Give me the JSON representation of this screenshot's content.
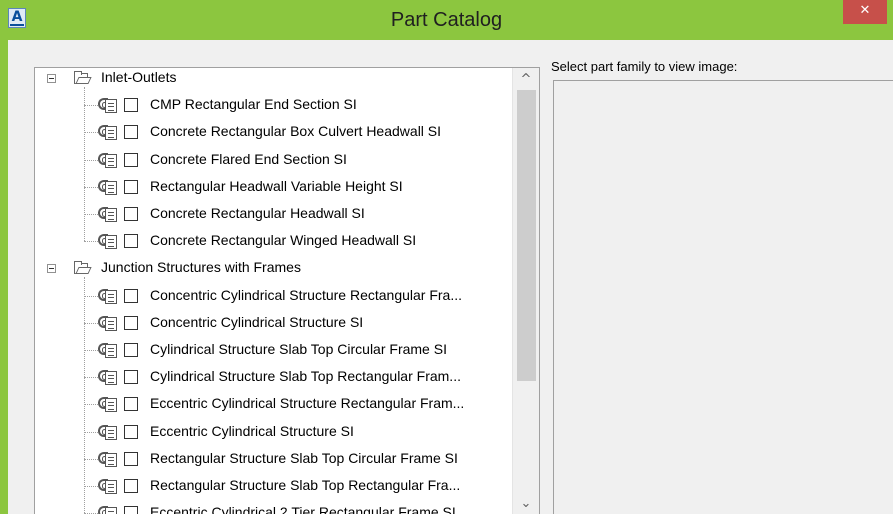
{
  "window": {
    "title": "Part Catalog",
    "app_icon_letter": "A",
    "close_glyph": "✕"
  },
  "tree": {
    "categories": [
      {
        "label": "Inlet-Outlets",
        "expander_icon": "minus-box-icon",
        "icon": "folder-open-icon",
        "items": [
          {
            "label": "CMP Rectangular End Section SI",
            "checked": false,
            "icon": "part-family-icon"
          },
          {
            "label": "Concrete Rectangular Box Culvert Headwall SI",
            "checked": false,
            "icon": "part-family-icon"
          },
          {
            "label": "Concrete Flared End Section SI",
            "checked": false,
            "icon": "part-family-icon"
          },
          {
            "label": "Rectangular Headwall Variable Height SI",
            "checked": false,
            "icon": "part-family-icon"
          },
          {
            "label": "Concrete Rectangular Headwall SI",
            "checked": false,
            "icon": "part-family-icon"
          },
          {
            "label": "Concrete Rectangular Winged Headwall SI",
            "checked": false,
            "icon": "part-family-icon"
          }
        ]
      },
      {
        "label": "Junction Structures with Frames",
        "expander_icon": "minus-box-icon",
        "icon": "folder-open-icon",
        "items": [
          {
            "label": "Concentric Cylindrical Structure Rectangular Fra...",
            "checked": false,
            "icon": "part-family-icon"
          },
          {
            "label": "Concentric Cylindrical Structure SI",
            "checked": false,
            "icon": "part-family-icon"
          },
          {
            "label": "Cylindrical Structure Slab Top Circular Frame SI",
            "checked": false,
            "icon": "part-family-icon"
          },
          {
            "label": "Cylindrical Structure Slab Top Rectangular Fram...",
            "checked": false,
            "icon": "part-family-icon"
          },
          {
            "label": "Eccentric Cylindrical Structure Rectangular Fram...",
            "checked": false,
            "icon": "part-family-icon"
          },
          {
            "label": "Eccentric Cylindrical Structure SI",
            "checked": false,
            "icon": "part-family-icon"
          },
          {
            "label": "Rectangular Structure Slab Top Circular Frame SI",
            "checked": false,
            "icon": "part-family-icon"
          },
          {
            "label": "Rectangular Structure Slab Top Rectangular Fra...",
            "checked": false,
            "icon": "part-family-icon"
          },
          {
            "label": "Eccentric Cylindrical 2 Tier Rectangular Frame SI",
            "checked": false,
            "icon": "part-family-icon"
          }
        ]
      }
    ],
    "scroll": {
      "up_glyph": "^",
      "down_glyph": "⌄",
      "thumb_position_fraction": 0.0,
      "visible_fraction": 0.72
    }
  },
  "preview": {
    "label": "Select part family to view image:"
  },
  "colors": {
    "title_bar": "#8cc63f",
    "close_button": "#c7504a",
    "panel_background": "#f0f0f0"
  }
}
